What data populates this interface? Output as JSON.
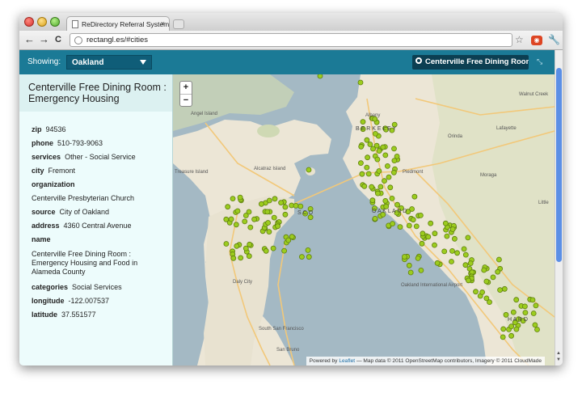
{
  "browser": {
    "tab_title": "ReDirectory Referral System",
    "tab_close": "×",
    "address": "rectangl.es/#cities",
    "back": "←",
    "forward": "→",
    "reload": "C",
    "star": "☆",
    "wrench": "🔧"
  },
  "app": {
    "showing_label": "Showing:",
    "city_select": "Oakland",
    "search_value": "Centerville Free Dining Room :",
    "collapse_icon": "⤡"
  },
  "sidebar": {
    "title": "Centerville Free Dining Room : Emergency Housing",
    "fields": {
      "zip_label": "zip",
      "zip": "94536",
      "phone_label": "phone",
      "phone": "510-793-9063",
      "services_label": "services",
      "services": "Other - Social Service",
      "city_label": "city",
      "city": "Fremont",
      "organization_label": "organization",
      "organization": "Centerville Presbyterian Church",
      "source_label": "source",
      "source": "City of Oakland",
      "address_label": "address",
      "address": "4360 Central Avenue",
      "name_label": "name",
      "name": "Centerville Free Dining Room : Emergency Housing and Food in Alameda County",
      "categories_label": "categories",
      "categories": "Social Services",
      "longitude_label": "longitude",
      "longitude": "-122.007537",
      "latitude_label": "latitude",
      "latitude": "37.551577"
    }
  },
  "map": {
    "zoom_in": "+",
    "zoom_out": "−",
    "attribution_prefix": "Powered by",
    "attribution_link": "Leaflet",
    "attribution_rest": "— Map data © 2011 OpenStreetMap contributors, Imagery © 2011 CloudMade",
    "labels": {
      "albany": "Albany",
      "walnut_creek": "Walnut Creek",
      "angel_island": "Angel Island",
      "alcatraz": "Alcatraz Island",
      "treasure": "Treasure Island",
      "piedmont": "Piedmont",
      "orinda": "Orinda",
      "lafayette": "Lafayette",
      "moraga": "Moraga",
      "airport": "Oakland International Airport",
      "daly_city": "Daly City",
      "south_sf": "South San Francisco",
      "san_bruno": "San Bruno",
      "berkeley": "B E R K E L E Y",
      "oakland": "O A K L A N D",
      "sf": "S C O",
      "hayward": "H A R D",
      "little": "Little"
    },
    "marker_color": "#9ccc1e",
    "water_color": "#a4b9c4",
    "land_color": "#ece6d6"
  }
}
